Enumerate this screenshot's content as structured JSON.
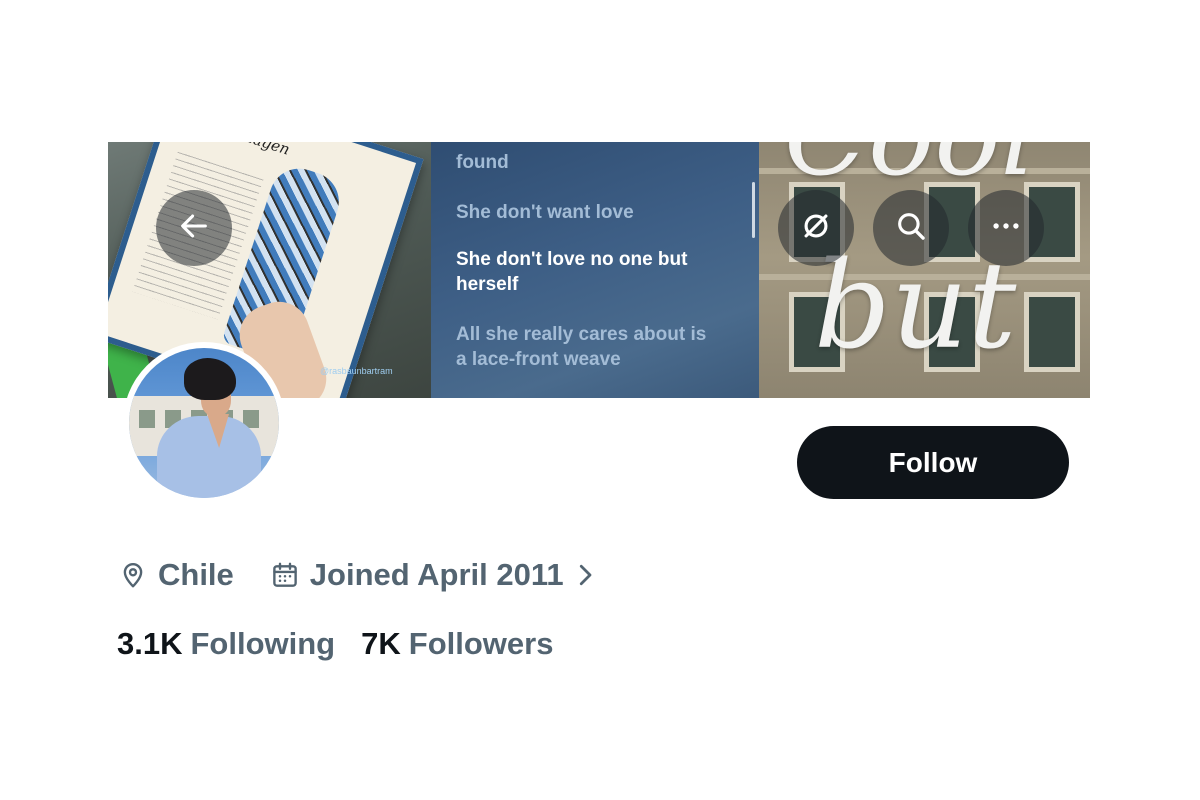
{
  "header": {
    "back_icon": "arrow-left-icon",
    "actions": [
      {
        "icon": "grok-slash-icon"
      },
      {
        "icon": "search-icon"
      },
      {
        "icon": "more-dots-icon"
      }
    ]
  },
  "banner": {
    "left_panel": {
      "script_text": "Copenhagen",
      "credit": "@rasbaunbartram"
    },
    "mid_panel": {
      "lyrics": [
        "found",
        "She don't want love",
        "She don't love no one but herself",
        "All she really cares about is a lace-front weave"
      ]
    },
    "right_panel": {
      "words": [
        "Cool",
        "but"
      ]
    }
  },
  "profile": {
    "follow_label": "Follow",
    "location_icon": "location-pin-icon",
    "location": "Chile",
    "calendar_icon": "calendar-icon",
    "joined": "Joined April 2011",
    "chevron_icon": "chevron-right-icon",
    "following_count": "3.1K",
    "following_label": "Following",
    "followers_count": "7K",
    "followers_label": "Followers"
  },
  "colors": {
    "text_primary": "#0f1419",
    "text_secondary": "#536471",
    "button_bg": "#0f1419"
  }
}
